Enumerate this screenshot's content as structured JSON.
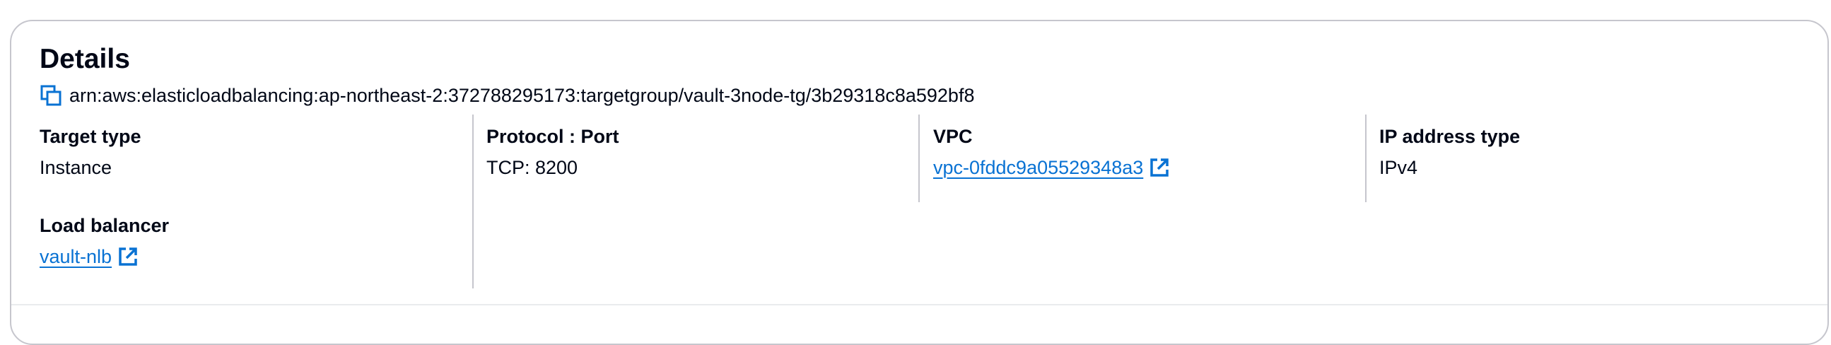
{
  "details": {
    "title": "Details",
    "arn": "arn:aws:elasticloadbalancing:ap-northeast-2:372788295173:targetgroup/vault-3node-tg/3b29318c8a592bf8"
  },
  "fields": {
    "target_type": {
      "label": "Target type",
      "value": "Instance"
    },
    "protocol_port": {
      "label": "Protocol : Port",
      "value": "TCP: 8200"
    },
    "vpc": {
      "label": "VPC",
      "value": "vpc-0fddc9a05529348a3"
    },
    "ip_address_type": {
      "label": "IP address type",
      "value": "IPv4"
    },
    "load_balancer": {
      "label": "Load balancer",
      "value": "vault-nlb"
    }
  },
  "icons": {
    "copy": "copy-icon",
    "external_link": "external-link-icon"
  },
  "colors": {
    "link": "#0972d3",
    "text": "#000716",
    "border": "#c6c6cd"
  }
}
